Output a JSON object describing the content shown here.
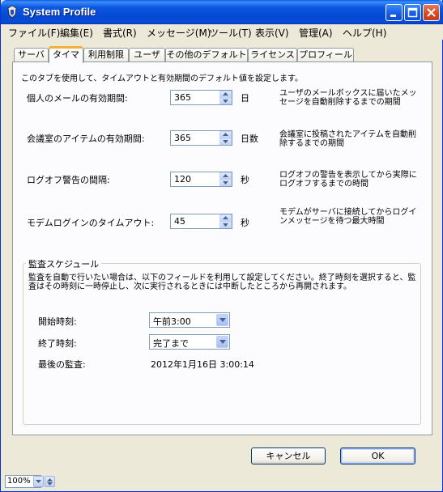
{
  "window": {
    "title": "System Profile"
  },
  "menu": [
    "ファイル(F)",
    "編集(E)",
    "書式(R)",
    "メッセージ(M)",
    "ツール(T)",
    "表示(V)",
    "管理(A)",
    "ヘルプ(H)"
  ],
  "tabs": [
    "サーバ",
    "タイマ",
    "利用制限",
    "ユーザ",
    "その他のデフォルト",
    "ライセンス",
    "プロフィール"
  ],
  "active_tab": "タイマ",
  "intro": "このタブを使用して、タイムアウトと有効期間のデフォルト値を設定します。",
  "settings": [
    {
      "label": "個人のメールの有効期間:",
      "value": "365",
      "unit": "日",
      "desc": "ユーザのメールボックスに届いたメッセージを自動削除するまでの期間"
    },
    {
      "label": "会議室のアイテムの有効期間:",
      "value": "365",
      "unit": "日数",
      "desc": "会議室に投稿されたアイテムを自動削除するまでの期間"
    },
    {
      "label": "ログオフ警告の間隔:",
      "value": "120",
      "unit": "秒",
      "desc": "ログオフの警告を表示してから実際にログオフするまでの時間"
    },
    {
      "label": "モデムログインのタイムアウト:",
      "value": "45",
      "unit": "秒",
      "desc": "モデムがサーバに接続してからログインメッセージを待つ最大時間"
    }
  ],
  "audit": {
    "title": "監査スケジュール",
    "description": "監査を自動で行いたい場合は、以下のフィールドを利用して設定してください。終了時刻を選択すると、監査はその時刻に一時停止し、次に実行されるときには中断したところから再開されます。",
    "start_label": "開始時刻:",
    "start_value": "午前3:00",
    "end_label": "終了時刻:",
    "end_value": "完了まで",
    "last_label": "最後の監査:",
    "last_value": "2012年1月16日 3:00:14"
  },
  "buttons": {
    "cancel": "キャンセル",
    "ok": "OK"
  },
  "status": {
    "zoom": "100%"
  }
}
